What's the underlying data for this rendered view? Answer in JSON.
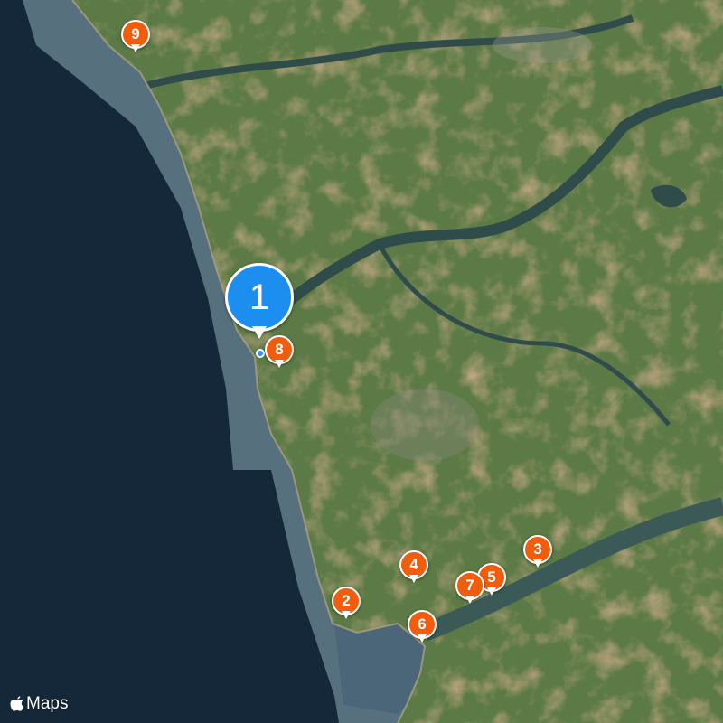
{
  "map": {
    "colors": {
      "sea": "#14283a",
      "shelf": "#56707e",
      "land": "#5c7a45",
      "river": "#2f4c4a"
    }
  },
  "pins": {
    "primary": {
      "label": "1",
      "color": "#1c8ef0"
    },
    "p2": {
      "label": "2",
      "color": "#f25c0d"
    },
    "p3": {
      "label": "3",
      "color": "#f25c0d"
    },
    "p4": {
      "label": "4",
      "color": "#f25c0d"
    },
    "p5": {
      "label": "5",
      "color": "#f25c0d"
    },
    "p6": {
      "label": "6",
      "color": "#f25c0d"
    },
    "p7": {
      "label": "7",
      "color": "#f25c0d"
    },
    "p8": {
      "label": "8",
      "color": "#f25c0d"
    },
    "p9": {
      "label": "9",
      "color": "#f25c0d"
    }
  },
  "brand": {
    "icon": "apple-logo-icon",
    "label": "Maps"
  }
}
